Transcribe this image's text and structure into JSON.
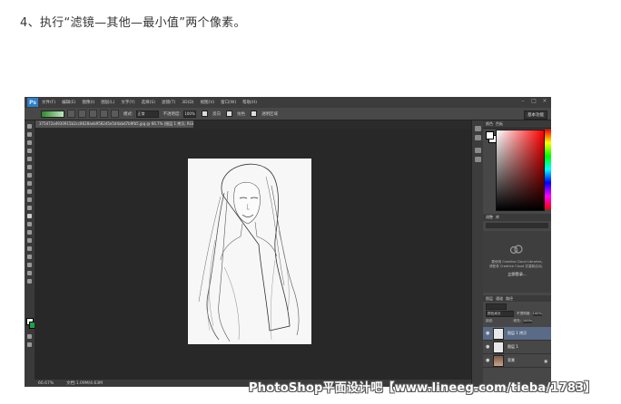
{
  "heading": "4、执行“滤镜—其他—最小值”两个像素。",
  "app": {
    "logo": "Ps",
    "menu": [
      "文件(F)",
      "编辑(E)",
      "图像(I)",
      "图层(L)",
      "文字(Y)",
      "选择(S)",
      "滤镜(T)",
      "3D(D)",
      "视图(V)",
      "窗口(W)",
      "帮助(H)"
    ],
    "options": {
      "mode_label": "模式:",
      "mode_value": "正常",
      "opacity_label": "不透明度:",
      "opacity_value": "100%",
      "reverse_label": "反向",
      "dither_label": "仿色",
      "transparency_label": "透明区域",
      "workspace": "基本功能"
    },
    "document_tab": "375472a4930915b2cc8628aeb9582d5e5d4abd7b9fb5.jpg @ 66.7% (图层 1 拷贝, RGB/8#) *",
    "status": {
      "zoom": "66.67%",
      "doc": "文档:1.09M/4.63M"
    },
    "panels": {
      "color_tabs": [
        "颜色",
        "色板"
      ],
      "library_tabs": [
        "调整",
        "库"
      ],
      "library_lines": [
        "要使用 Creative Cloud Libraries,",
        "请登录 Creative Cloud 并重新启动。"
      ],
      "library_action": "立即登录...",
      "layers_tabs": [
        "图层",
        "通道",
        "路径"
      ],
      "layers_blend": "颜色减淡",
      "layers_opacity_label": "不透明度:",
      "layers_opacity_value": "100%",
      "layers_fill_label": "填充:",
      "layers_fill_value": "100%",
      "layers_lock_label": "锁定:",
      "layers": [
        {
          "name": "图层 1 拷贝",
          "active": true,
          "thumb": "sketch"
        },
        {
          "name": "图层 1",
          "active": false,
          "thumb": "sketch"
        },
        {
          "name": "背景",
          "active": false,
          "thumb": "photo"
        }
      ]
    }
  },
  "watermark": "PhotoShop平面设计吧【www.lineeg.com/tieba/1783】"
}
